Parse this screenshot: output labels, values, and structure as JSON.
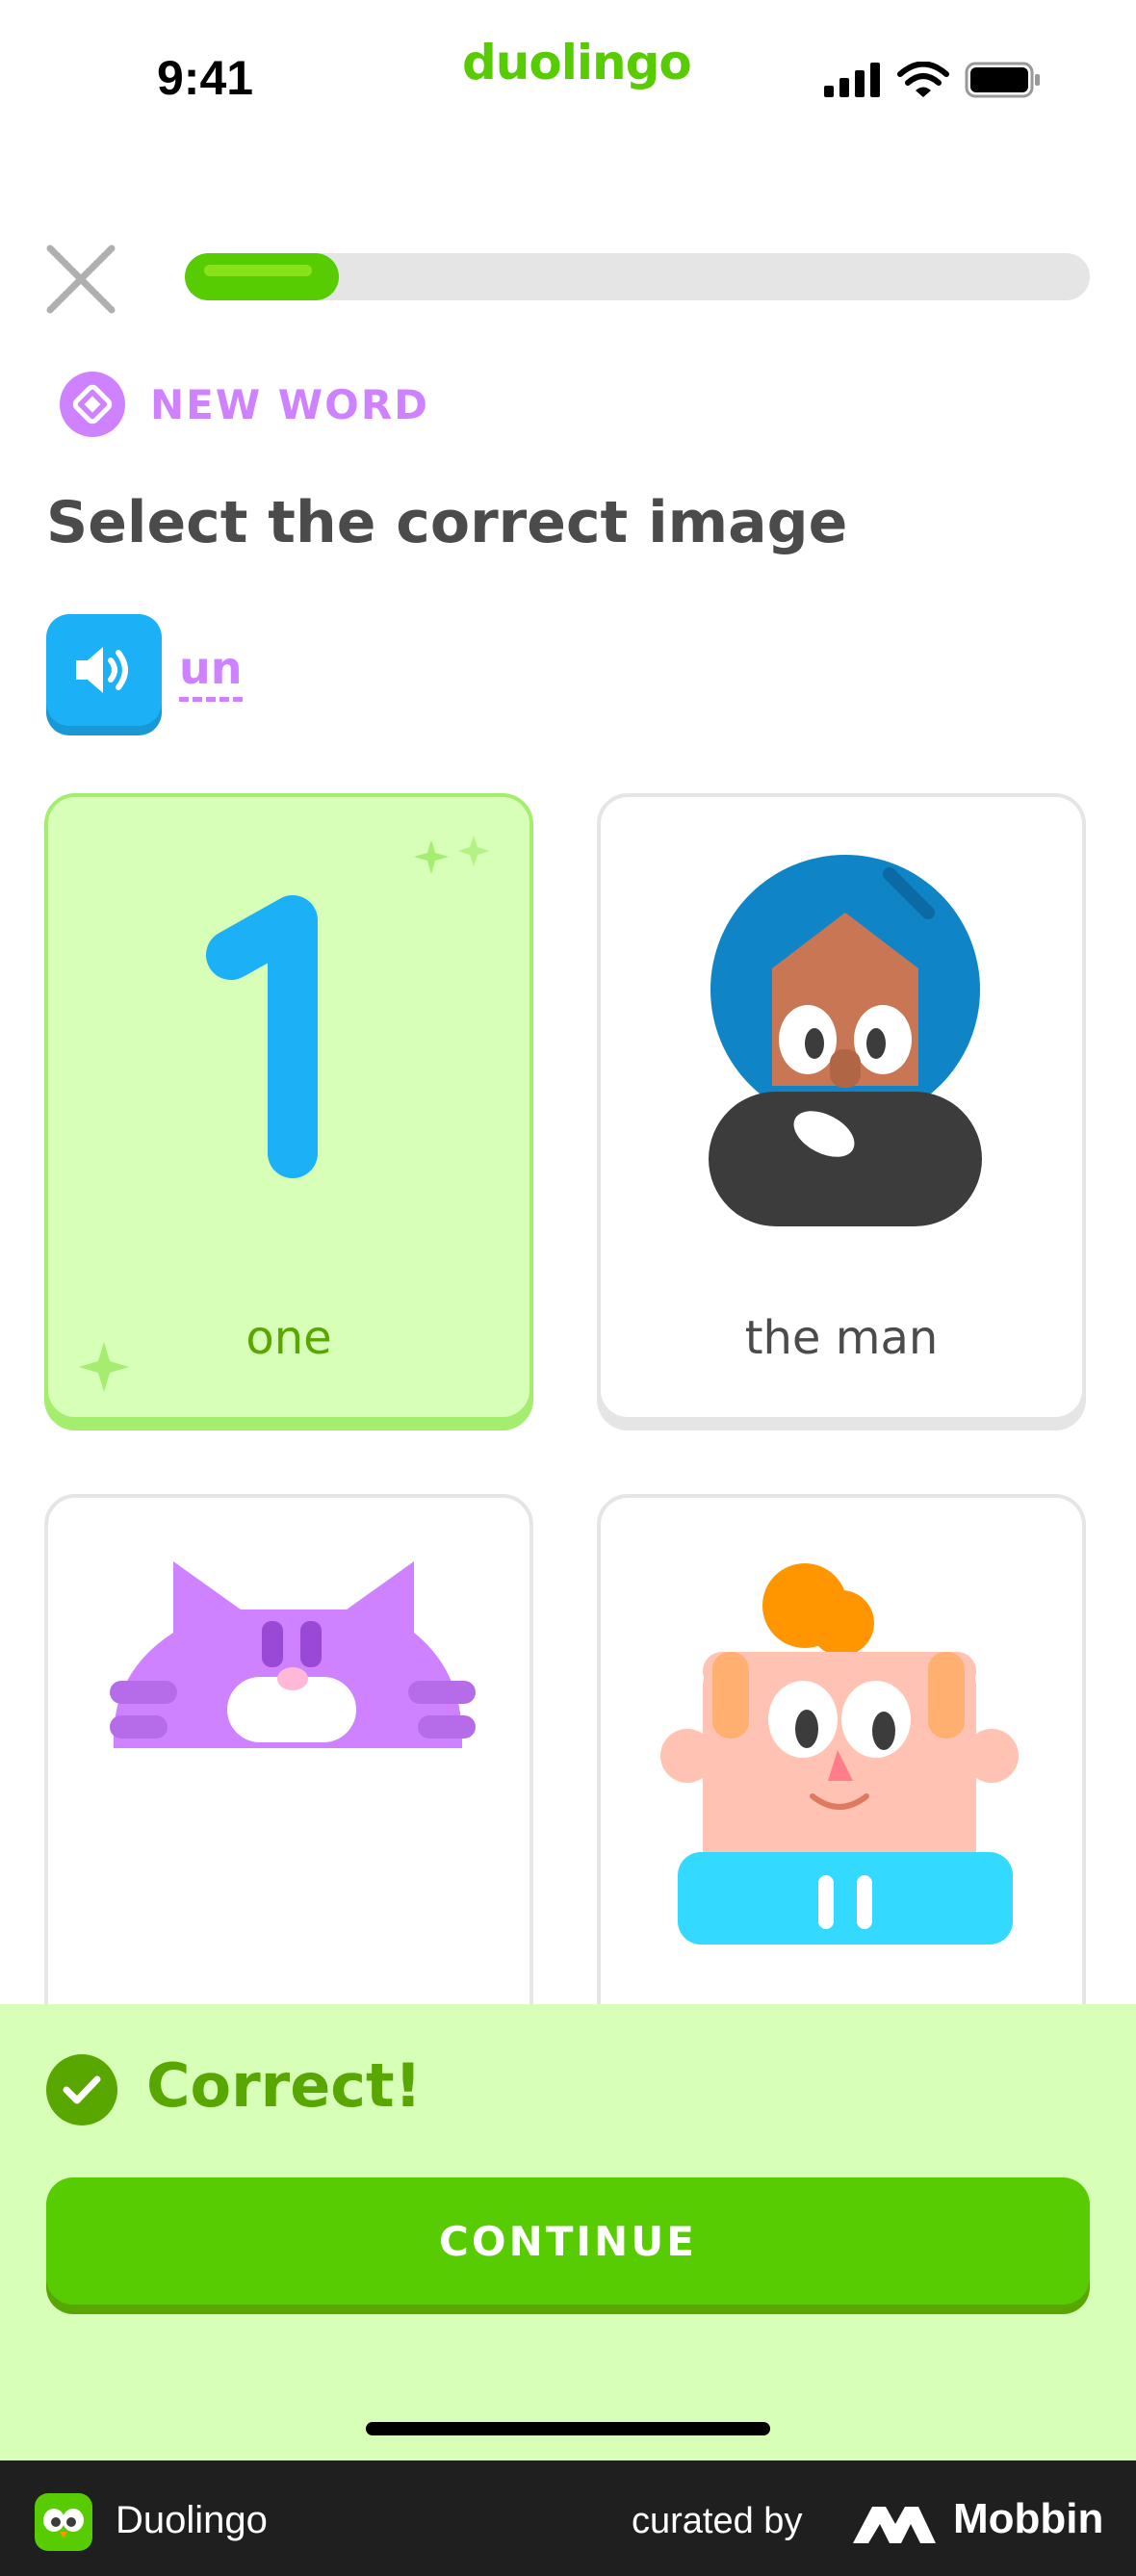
{
  "status_bar": {
    "time": "9:41",
    "brand": "duolingo"
  },
  "lesson": {
    "progress": 0.17,
    "badge": "NEW WORD",
    "prompt": "Select the correct image",
    "word": "un"
  },
  "cards": [
    {
      "label": "one",
      "selected": true
    },
    {
      "label": "the man",
      "selected": false
    },
    {
      "label": "",
      "selected": false
    },
    {
      "label": "",
      "selected": false
    }
  ],
  "feedback": {
    "message": "Correct!",
    "button": "CONTINUE"
  },
  "footer": {
    "app_name": "Duolingo",
    "curated_by": "curated by",
    "brand": "Mobbin"
  },
  "colors": {
    "green": "#58cc02",
    "dark_green": "#58a700",
    "purple": "#ce82ff",
    "blue": "#1cb0f6",
    "sheet": "#d7ffb8"
  }
}
